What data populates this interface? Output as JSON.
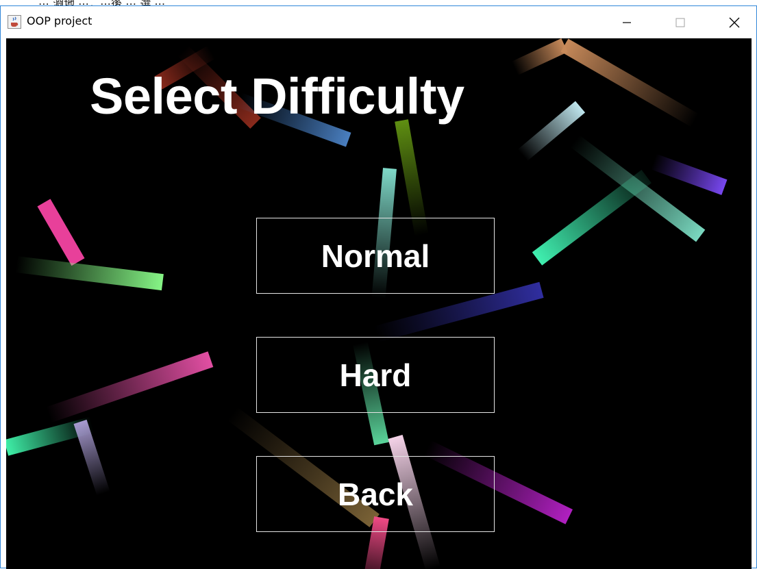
{
  "window": {
    "title": "OOP project",
    "icon": "java-coffee-cup-icon",
    "controls": [
      "minimize-icon",
      "maximize-icon",
      "close-icon"
    ]
  },
  "screen": {
    "heading": "Select Difficulty",
    "buttons": {
      "normal": "Normal",
      "hard": "Hard",
      "back": "Back"
    },
    "background_color": "#000000",
    "button_border_color": "#e6e6e6"
  },
  "partial_text": "⋯ 淵地 ⋯，⋯後 ⋯ 選 ⋯"
}
